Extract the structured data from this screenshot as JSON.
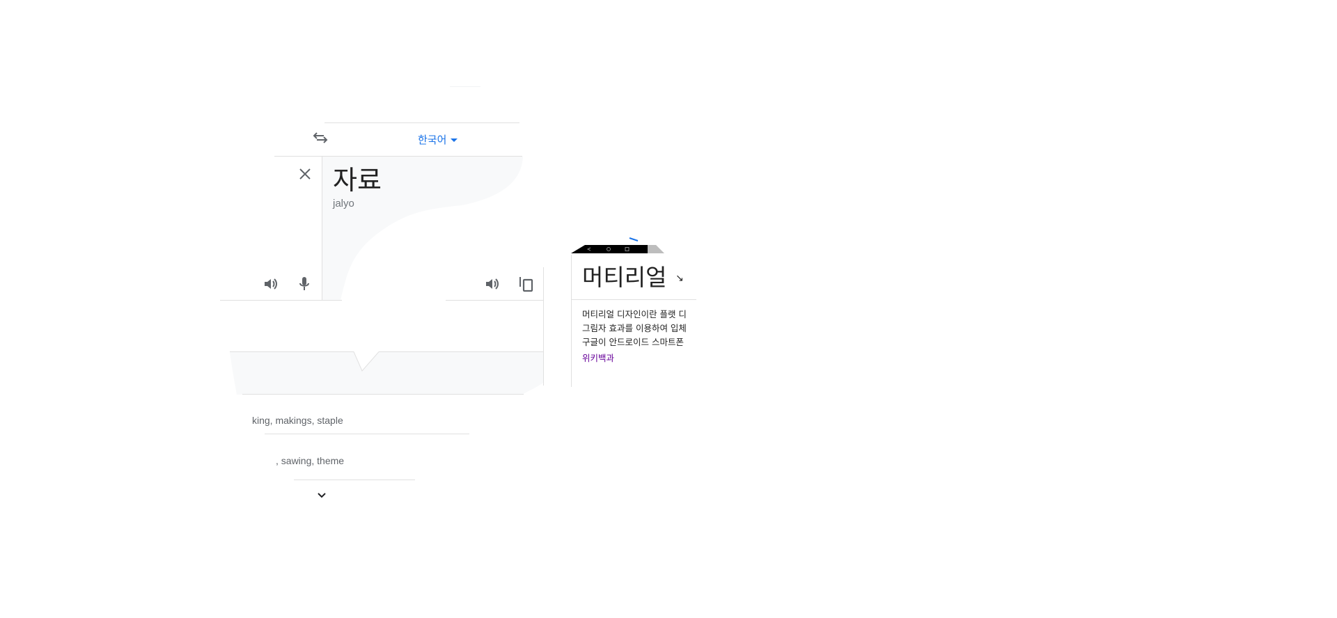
{
  "translator": {
    "target_language": "한국어",
    "translation": "자료",
    "romanization": "jalyo",
    "swap_icon": "swap-arrows-icon",
    "clear_icon": "close-icon"
  },
  "suggestions": [
    "king, makings, staple",
    ", sawing, theme"
  ],
  "knowledge_card": {
    "title": "머티리얼",
    "lines": [
      "머티리얼 디자인이란 플랫 디",
      "그림자 효과를 이용하여 입체",
      "구글이 안드로이드 스마트폰"
    ],
    "source": "위키백과"
  }
}
